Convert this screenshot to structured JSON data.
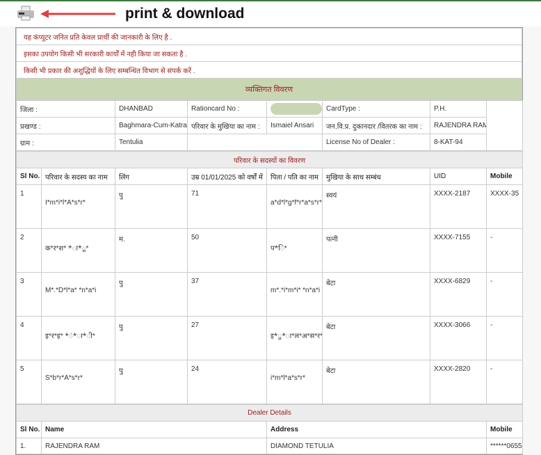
{
  "annotation": {
    "label": "print & download"
  },
  "notes": [
    "यह कंप्यूटर जनित प्रति केवल प्रार्थी की जानकारी के लिए है .",
    "इसका उपयोग किसी भी सरकारी कार्यों में नही किया जा सकता है .",
    "किसी भी प्रकार की अशुद्धियों के लिए सम्बन्धित विभाग से संपर्क करें ."
  ],
  "personal": {
    "title": "व्यक्तिगत विवरण",
    "district_label": "जिला :",
    "district": "DHANBAD",
    "ration_label": "Rationcard No :",
    "cardtype_label": "CardType :",
    "cardtype": "P.H.",
    "block_label": "प्रखण्ड :",
    "block": "Baghmara-Cum-Katras",
    "head_label": "परिवार के मुखिया का नाम :",
    "head": "Ismaiel Ansari",
    "dealer_label": "जन.वि.प्र. दुकानदार /वितरक का नाम :",
    "dealer": "RAJENDRA RAM",
    "village_label": "ग्राम :",
    "village": "Tentulia",
    "license_label": "License No of Dealer :",
    "license": "8-KAT-94"
  },
  "members": {
    "title": "परिवार के सदस्यों का विवरण",
    "headers": [
      "Sl No.",
      "परिवार के सदस्य का नाम",
      "लिंग",
      "उम्र 01/01/2025 को वर्षों में",
      "पिता / पति का नाम",
      "मुखिया के साथ सम्बंध",
      "UID",
      "Mobile"
    ],
    "rows": [
      [
        "1",
        "I*m*i*l*A*s*r*",
        "पु",
        "71",
        "a*d*l*g*f*r*a*s*r*",
        "स्वयं",
        "XXXX-2187",
        "XXXX-35"
      ],
      [
        "2",
        "क*र*श* *ा*ू*",
        "म.",
        "50",
        "प*ि*",
        "पत्नी",
        "XXXX-7155",
        "-"
      ],
      [
        "3",
        "M*.*D*l*a* *n*a*i",
        "पु",
        "37",
        "m*.*i*m*i* *n*a*i",
        "बेटा",
        "XXXX-6829",
        "-"
      ],
      [
        "4",
        "इ*र*इ* *ं*ा*ी*",
        "पु",
        "27",
        "इ*ु*ा*ल*अ*स*र*",
        "बेटा",
        "XXXX-3066",
        "-"
      ],
      [
        "5",
        "S*b*r*A*s*r*",
        "पु",
        "24",
        "i*m*l*a*s*r*",
        "बेटा",
        "XXXX-2820",
        "-"
      ]
    ]
  },
  "dealer": {
    "title": "Dealer Details",
    "headers": [
      "Sl No.",
      "Name",
      "Address",
      "Mobile"
    ],
    "rows": [
      [
        "1.",
        "RAJENDRA RAM",
        "DIAMOND TETULIA",
        "******0655"
      ]
    ]
  }
}
